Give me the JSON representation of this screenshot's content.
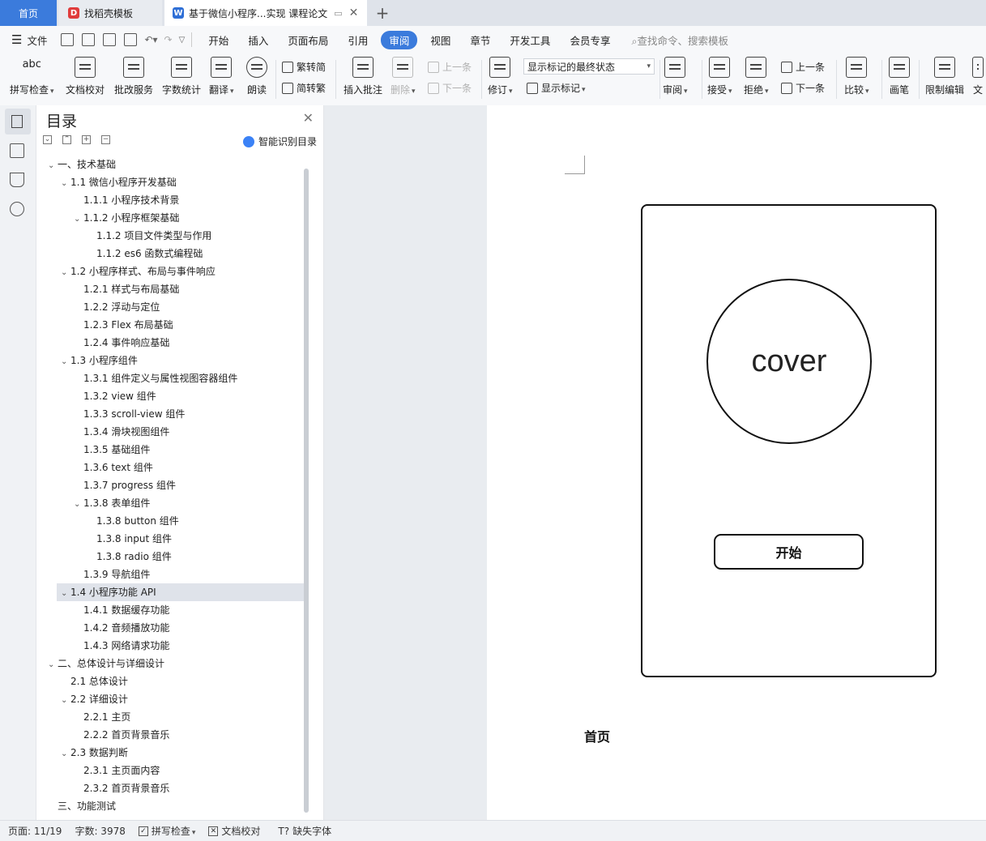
{
  "tabs": [
    {
      "label": "首页"
    },
    {
      "label": "找稻壳模板"
    },
    {
      "label": "基于微信小程序...实现 课程论文"
    }
  ],
  "menu": {
    "file": "文件",
    "items": [
      "开始",
      "插入",
      "页面布局",
      "引用",
      "审阅",
      "视图",
      "章节",
      "开发工具",
      "会员专享"
    ],
    "active": "审阅",
    "search_placeholder": "查找命令、搜索模板"
  },
  "ribbon": {
    "spell": "拼写检查",
    "proof": "文档校对",
    "review_service": "批改服务",
    "word_count": "字数统计",
    "translate": "翻译",
    "read_aloud": "朗读",
    "trad_to_simp": "繁转简",
    "simp_to_trad": "简转繁",
    "insert_comment": "插入批注",
    "delete": "删除",
    "prev": "上一条",
    "next": "下一条",
    "track": "修订",
    "markup_state": "显示标记的最终状态",
    "show_markup": "显示标记",
    "review": "审阅",
    "accept": "接受",
    "reject": "拒绝",
    "prev2": "上一条",
    "next2": "下一条",
    "compare": "比较",
    "ink": "画笔",
    "restrict": "限制编辑",
    "doc_cut": "文"
  },
  "toc": {
    "title": "目录",
    "smart": "智能识别目录",
    "items": [
      {
        "text": "一、技术基础",
        "level": 0,
        "arrow": "⌄"
      },
      {
        "text": "1.1  微信小程序开发基础",
        "level": 1,
        "arrow": "⌄"
      },
      {
        "text": "1.1.1  小程序技术背景",
        "level": 2,
        "arrow": ""
      },
      {
        "text": "1.1.2  小程序框架基础",
        "level": 2,
        "arrow": "⌄"
      },
      {
        "text": "1.1.2  项目文件类型与作用",
        "level": 3,
        "arrow": ""
      },
      {
        "text": "1.1.2 es6  函数式编程础",
        "level": 3,
        "arrow": ""
      },
      {
        "text": "1.2  小程序样式、布局与事件响应",
        "level": 1,
        "arrow": "⌄"
      },
      {
        "text": "1.2.1  样式与布局基础",
        "level": 2,
        "arrow": ""
      },
      {
        "text": "1.2.2  浮动与定位",
        "level": 2,
        "arrow": ""
      },
      {
        "text": "1.2.3 Flex  布局基础",
        "level": 2,
        "arrow": ""
      },
      {
        "text": "1.2.4  事件响应基础",
        "level": 2,
        "arrow": ""
      },
      {
        "text": "1.3  小程序组件",
        "level": 1,
        "arrow": "⌄"
      },
      {
        "text": "1.3.1  组件定义与属性视图容器组件",
        "level": 2,
        "arrow": ""
      },
      {
        "text": "1.3.2 view  组件",
        "level": 2,
        "arrow": ""
      },
      {
        "text": "1.3.3 scroll-view  组件",
        "level": 2,
        "arrow": ""
      },
      {
        "text": "1.3.4  滑块视图组件",
        "level": 2,
        "arrow": ""
      },
      {
        "text": "1.3.5  基础组件",
        "level": 2,
        "arrow": ""
      },
      {
        "text": "1.3.6 text  组件",
        "level": 2,
        "arrow": ""
      },
      {
        "text": "1.3.7 progress  组件",
        "level": 2,
        "arrow": ""
      },
      {
        "text": "1.3.8  表单组件",
        "level": 2,
        "arrow": "⌄"
      },
      {
        "text": "1.3.8 button  组件",
        "level": 3,
        "arrow": ""
      },
      {
        "text": "1.3.8 input  组件",
        "level": 3,
        "arrow": ""
      },
      {
        "text": "1.3.8 radio  组件",
        "level": 3,
        "arrow": ""
      },
      {
        "text": "1.3.9  导航组件",
        "level": 2,
        "arrow": ""
      },
      {
        "text": "1.4  小程序功能  API",
        "level": 1,
        "arrow": "⌄",
        "selected": true
      },
      {
        "text": "1.4.1  数据缓存功能",
        "level": 2,
        "arrow": ""
      },
      {
        "text": "1.4.2  音频播放功能",
        "level": 2,
        "arrow": ""
      },
      {
        "text": "1.4.3  网络请求功能",
        "level": 2,
        "arrow": ""
      },
      {
        "text": "二、总体设计与详细设计",
        "level": 0,
        "arrow": "⌄"
      },
      {
        "text": "2.1  总体设计",
        "level": 1,
        "arrow": ""
      },
      {
        "text": "2.2  详细设计",
        "level": 1,
        "arrow": "⌄"
      },
      {
        "text": "2.2.1  主页",
        "level": 2,
        "arrow": ""
      },
      {
        "text": "2.2.2  首页背景音乐",
        "level": 2,
        "arrow": ""
      },
      {
        "text": "2.3  数据判断",
        "level": 1,
        "arrow": "⌄"
      },
      {
        "text": "2.3.1  主页面内容",
        "level": 2,
        "arrow": ""
      },
      {
        "text": "2.3.2  首页背景音乐",
        "level": 2,
        "arrow": ""
      },
      {
        "text": "三、功能测试",
        "level": 0,
        "arrow": ""
      }
    ]
  },
  "document": {
    "cover_text": "cover",
    "start_button": "开始",
    "caption": "首页"
  },
  "status": {
    "page": "页面: 11/19",
    "words": "字数: 3978",
    "spell": "拼写检查",
    "proof": "文档校对",
    "missing_font": "缺失字体"
  },
  "colors": {
    "accent": "#3b7bdc"
  }
}
